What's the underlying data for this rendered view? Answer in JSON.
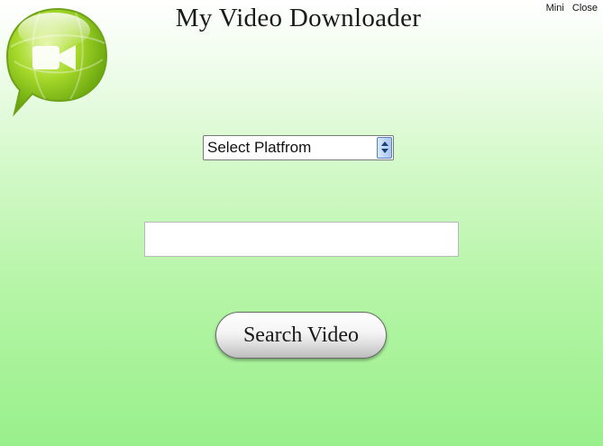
{
  "app": {
    "title": "My Video Downloader",
    "logo_icon": "video-camera-speech-bubble-icon"
  },
  "window_controls": {
    "mini_label": "Mini",
    "close_label": "Close"
  },
  "platform_select": {
    "selected": "Select Platfrom"
  },
  "url_input": {
    "value": "",
    "placeholder": ""
  },
  "search_button": {
    "label": "Search Video"
  },
  "colors": {
    "background_top": "#ffffff",
    "background_bottom": "#99f08b",
    "logo_green": "#8fd11a"
  }
}
